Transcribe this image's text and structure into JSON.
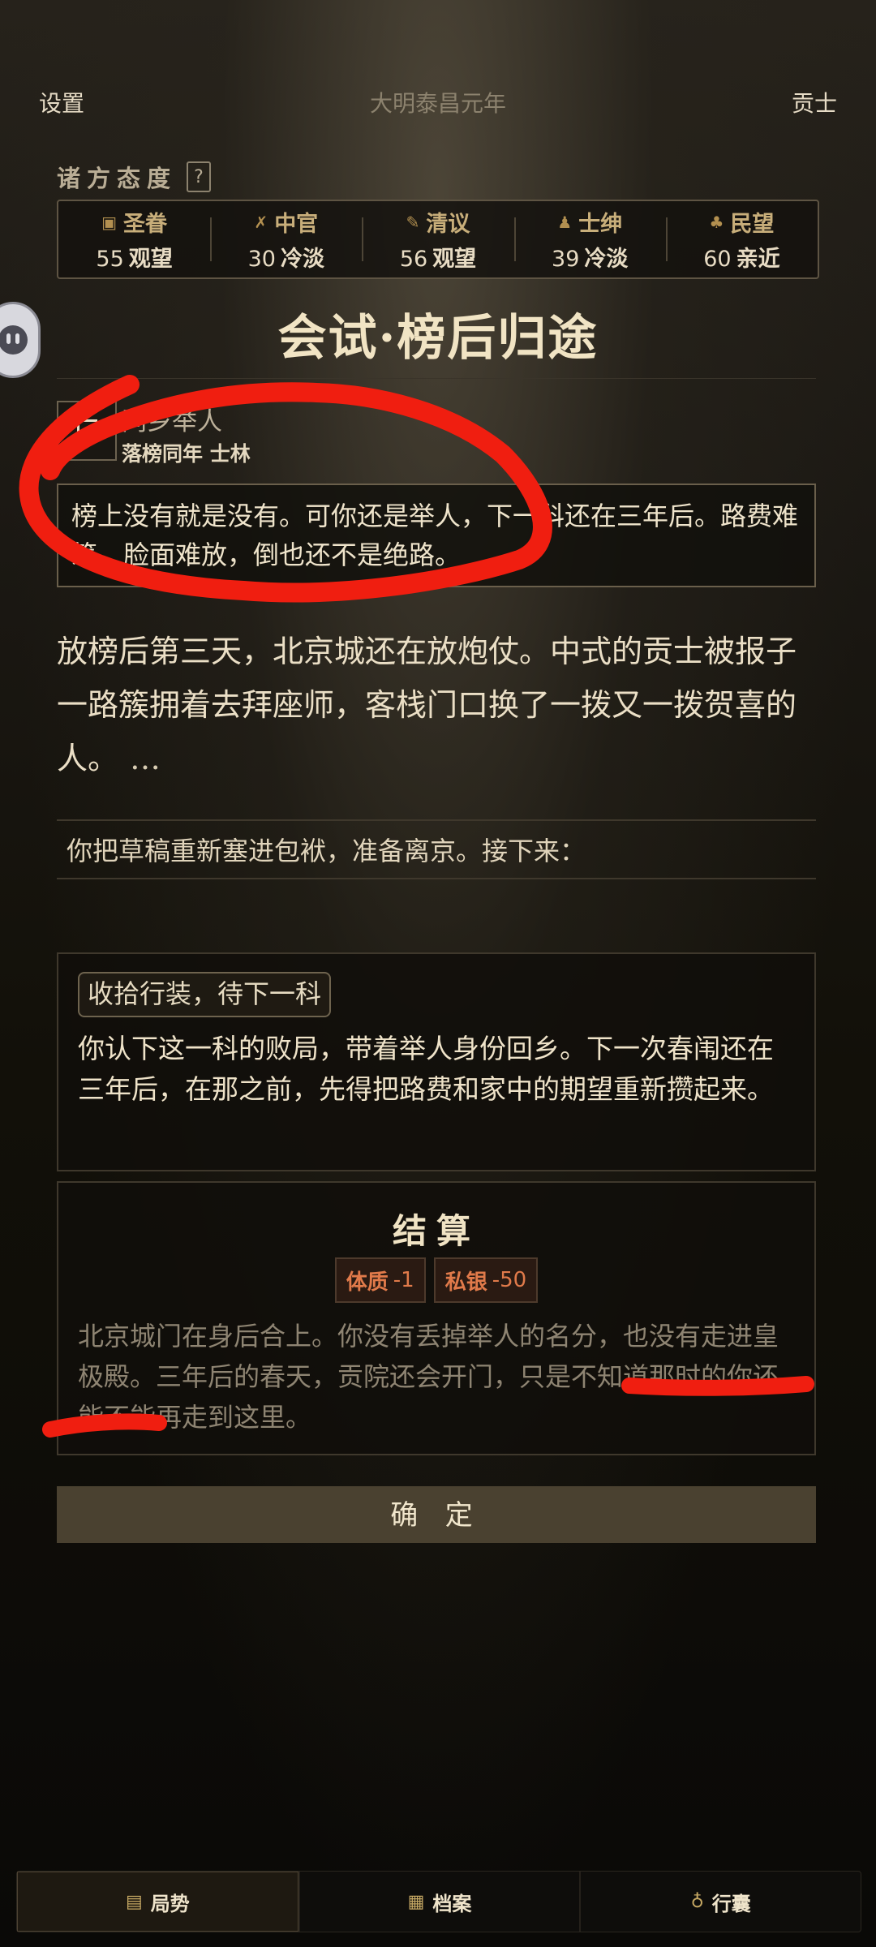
{
  "header": {
    "left": "设置",
    "center": "大明泰昌元年",
    "right": "贡士"
  },
  "attitudes": {
    "title": "诸方态度",
    "help": "?",
    "items": [
      {
        "name": "圣眷",
        "value": "55",
        "status": "观望",
        "icon": "seal-icon"
      },
      {
        "name": "中官",
        "value": "30",
        "status": "冷淡",
        "icon": "whisk-icon"
      },
      {
        "name": "清议",
        "value": "56",
        "status": "观望",
        "icon": "brush-icon"
      },
      {
        "name": "士绅",
        "value": "39",
        "status": "冷淡",
        "icon": "person-icon"
      },
      {
        "name": "民望",
        "value": "60",
        "status": "亲近",
        "icon": "crowd-icon"
      }
    ]
  },
  "scene": {
    "title": "会试·榜后归途",
    "speaker_name": "同乡举人",
    "speaker_sub": "落榜同年 士林",
    "quote": "榜上没有就是没有。可你还是举人，下一科还在三年后。路费难筹，脸面难放，倒也还不是绝路。",
    "narration": "放榜后第三天，北京城还在放炮仗。中式的贡士被报子一路簇拥着去拜座师，客栈门口换了一拨又一拨贺喜的人。",
    "more": "…",
    "prompt": "你把草稿重新塞进包袱，准备离京。接下来："
  },
  "option": {
    "tag": "收拾行装，待下一科",
    "desc": "你认下这一科的败局，带着举人身份回乡。下一次春闱还在三年后，在那之前，先得把路费和家中的期望重新攒起来。"
  },
  "result": {
    "title": "结算",
    "tags": [
      {
        "label": "体质",
        "delta": "-1"
      },
      {
        "label": "私银",
        "delta": "-50"
      }
    ],
    "text": "北京城门在身后合上。你没有丢掉举人的名分，也没有走进皇极殿。三年后的春天，贡院还会开门，只是不知道那时的你还能不能再走到这里。"
  },
  "confirm_label": "确 定",
  "nav": [
    {
      "label": "局势",
      "icon": "book-icon"
    },
    {
      "label": "档案",
      "icon": "file-icon"
    },
    {
      "label": "行囊",
      "icon": "bag-icon"
    }
  ],
  "colors": {
    "accent_gold": "#c8ae7a",
    "negative": "#e07a4a",
    "annotation": "#f01e10"
  }
}
